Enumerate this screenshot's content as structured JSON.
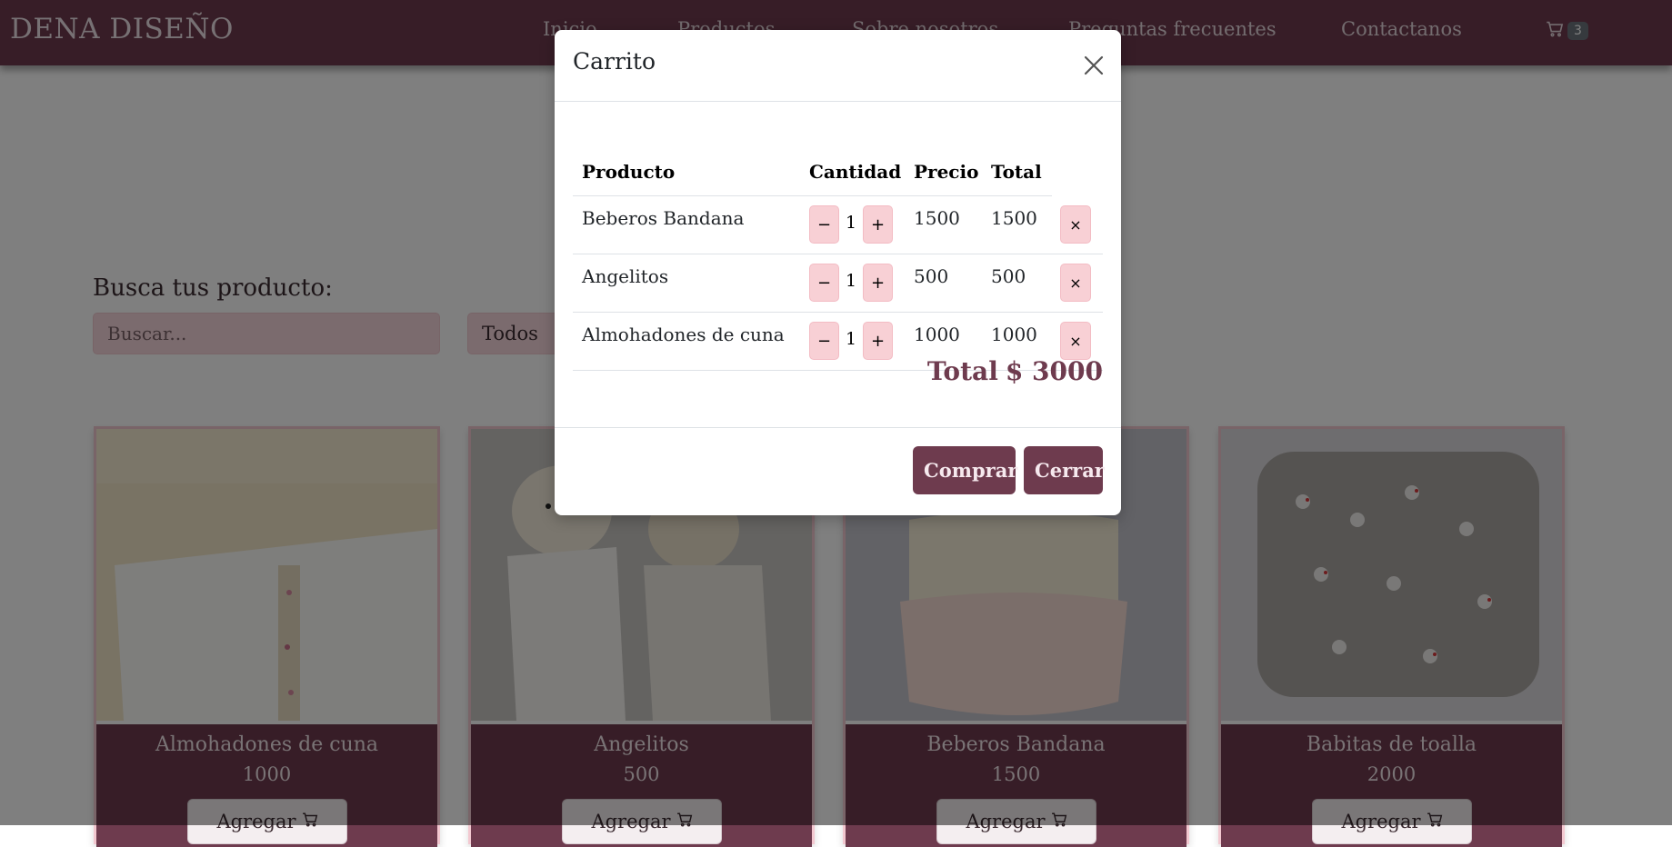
{
  "navbar": {
    "brand": "DENA DISEÑO",
    "links": [
      "Inicio",
      "Productos",
      "Sobre nosotros",
      "Preguntas frecuentes",
      "Contactanos"
    ],
    "cart_count": "3",
    "cart_icon": "cart-icon"
  },
  "search": {
    "title": "Busca tus producto:",
    "placeholder": "Buscar...",
    "filter_value": "Todos"
  },
  "products": [
    {
      "name": "Almohadones de cuna",
      "price": "1000",
      "button": "Agregar"
    },
    {
      "name": "Angelitos",
      "price": "500",
      "button": "Agregar"
    },
    {
      "name": "Beberos Bandana",
      "price": "1500",
      "button": "Agregar"
    },
    {
      "name": "Babitas de toalla",
      "price": "2000",
      "button": "Agregar"
    }
  ],
  "modal": {
    "title": "Carrito",
    "columns": [
      "Producto",
      "Cantidad",
      "Precio",
      "Total"
    ],
    "items": [
      {
        "name": "Beberos Bandana",
        "qty": "1",
        "price": "1500",
        "total": "1500"
      },
      {
        "name": "Angelitos",
        "qty": "1",
        "price": "500",
        "total": "500"
      },
      {
        "name": "Almohadones de cuna",
        "qty": "1",
        "price": "1000",
        "total": "1000"
      }
    ],
    "decrement_label": "−",
    "increment_label": "+",
    "remove_label": "×",
    "total_label": "Total",
    "total_value": "$ 3000",
    "buy_button": "Comprar",
    "close_button": "Cerrar"
  },
  "colors": {
    "brand": "#6e3b4e",
    "pink_button": "#f8d0d5",
    "input_bg": "#f7d7dc"
  }
}
